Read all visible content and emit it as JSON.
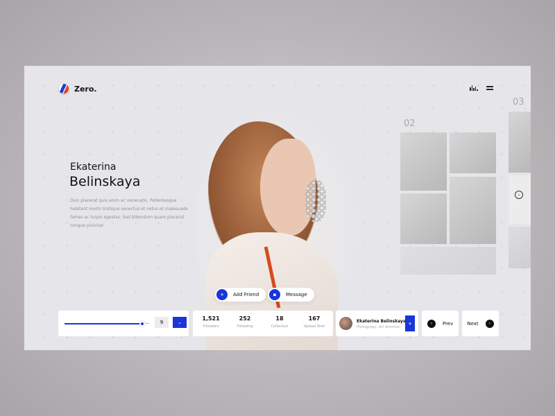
{
  "brand": {
    "name": "Zero."
  },
  "header": {
    "icons": [
      "bar-chart-icon",
      "menu-icon"
    ]
  },
  "profile": {
    "first_name": "Ekaterina",
    "last_name": "Belinskaya",
    "description": "Duis placerat quis enim ac venenatis. Pellentesque habitant morbi tristique senectus et netus et malesuada fames ac turpis egestas. Sed bibendum quam placerat congue pulvinar."
  },
  "actions": {
    "add_friend": "Add Friend",
    "message": "Message"
  },
  "gallery": {
    "label_02": "02",
    "label_03": "03"
  },
  "slider": {
    "value": "9",
    "fill": 0.92
  },
  "stats": [
    {
      "value": "1,521",
      "label": "Followers"
    },
    {
      "value": "252",
      "label": "Following"
    },
    {
      "value": "18",
      "label": "Collection"
    },
    {
      "value": "167",
      "label": "Upload Shot"
    }
  ],
  "user_card": {
    "name": "Ekaterina Belinskaya",
    "role": "Photograpy, Art direction"
  },
  "pagination": {
    "prev": "Prev",
    "next": "Next"
  },
  "colors": {
    "accent": "#1a35d8",
    "background": "#e6e6ea"
  }
}
